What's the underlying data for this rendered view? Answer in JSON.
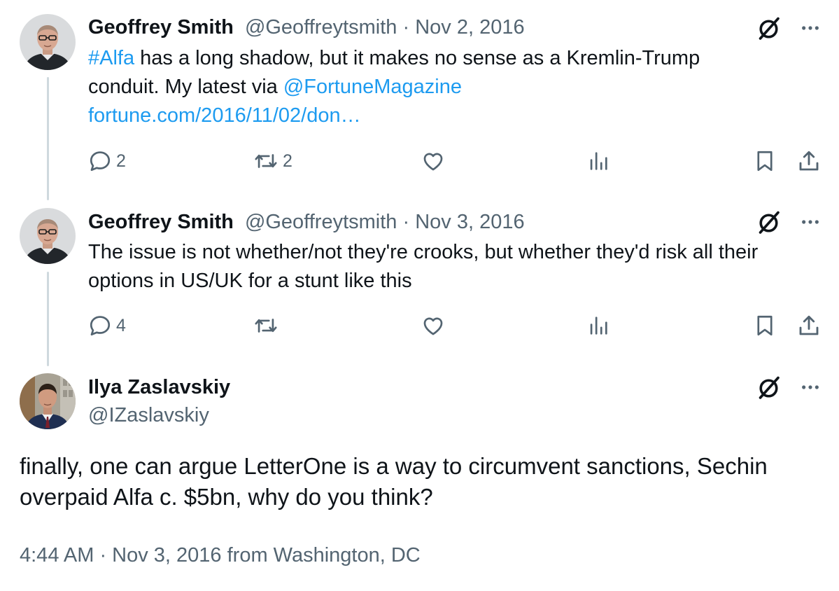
{
  "tweets": [
    {
      "name": "Geoffrey Smith",
      "handle": "@Geoffreytsmith",
      "date": "Nov 2, 2016",
      "text_hashtag": "#Alfa",
      "text_part1": " has a long shadow, but it makes no sense as a Kremlin-Trump conduit. My latest via ",
      "text_mention": "@FortuneMagazine",
      "text_link": "fortune.com/2016/11/02/don…",
      "reply_count": "2",
      "retweet_count": "2"
    },
    {
      "name": "Geoffrey Smith",
      "handle": "@Geoffreytsmith",
      "date": "Nov 3, 2016",
      "text": "The issue is not whether/not they're crooks, but whether they'd risk all their options in US/UK for a stunt like this",
      "reply_count": "4"
    }
  ],
  "main_tweet": {
    "name": "Ilya Zaslavskiy",
    "handle": "@IZaslavskiy",
    "text": "finally, one can argue LetterOne is a way to circumvent sanctions, Sechin overpaid Alfa c. $5bn, why do you think?",
    "timestamp": "4:44 AM · Nov 3, 2016 from Washington, DC"
  },
  "separator": " · ",
  "icons": {
    "grok": "grok-icon",
    "more": "more-icon",
    "reply": "reply-icon",
    "retweet": "retweet-icon",
    "like": "like-icon",
    "views": "views-icon",
    "bookmark": "bookmark-icon",
    "share": "share-icon"
  },
  "colors": {
    "link": "#1d9bf0",
    "secondary_text": "#536471",
    "thread_line": "#cfd9de"
  }
}
